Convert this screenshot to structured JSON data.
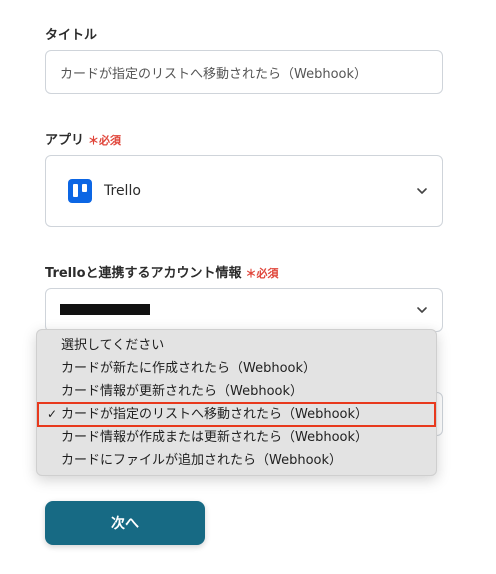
{
  "form": {
    "title_label": "タイトル",
    "title_value": "カードが指定のリストへ移動されたら（Webhook）",
    "app_label": "アプリ",
    "required_mark": "＊必須",
    "app_name": "Trello",
    "account_label": "Trelloと連携するアカウント情報",
    "account_required_mark": "＊必須"
  },
  "dropdown": {
    "options": [
      "選択してください",
      "カードが新たに作成されたら（Webhook）",
      "カード情報が更新されたら（Webhook）",
      "カードが指定のリストへ移動されたら（Webhook）",
      "カード情報が作成または更新されたら（Webhook）",
      "カードにファイルが追加されたら（Webhook）"
    ],
    "selected_index": 3,
    "check_mark": "✓"
  },
  "buttons": {
    "next_label": "次へ"
  },
  "icons": {
    "app_logo": "trello-logo-icon",
    "chevron": "chevron-down-icon"
  },
  "colors": {
    "accent": "#176a84",
    "required": "#e0453a",
    "highlight": "#e8391d",
    "trello": "#0c66e4"
  }
}
